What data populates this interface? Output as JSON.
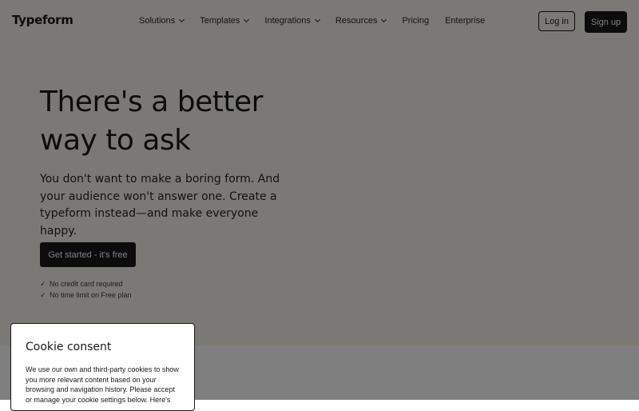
{
  "header": {
    "logo": "Typeform",
    "nav": [
      {
        "label": "Solutions",
        "has_dropdown": true
      },
      {
        "label": "Templates",
        "has_dropdown": true
      },
      {
        "label": "Integrations",
        "has_dropdown": true
      },
      {
        "label": "Resources",
        "has_dropdown": true
      },
      {
        "label": "Pricing",
        "has_dropdown": false
      },
      {
        "label": "Enterprise",
        "has_dropdown": false
      }
    ],
    "login_label": "Log in",
    "signup_label": "Sign up"
  },
  "hero": {
    "title": "There's a better way to ask",
    "subtitle": "You don't want to make a boring form. And your audience won't answer one. Create a typeform instead—and make everyone happy.",
    "cta_label": "Get started - it's free",
    "checks": [
      "No credit card required",
      "No time limit on Free plan"
    ],
    "check_icon": "✓"
  },
  "cookie": {
    "title": "Cookie consent",
    "body": "We use our own and third-party cookies to show you more relevant content based on your browsing and navigation history. Please accept or manage your cookie settings below. Here's"
  },
  "colors": {
    "background": "#f5f2ed",
    "text": "#191919",
    "button_dark": "#191919",
    "overlay": "rgba(0,0,0,0.5)"
  }
}
